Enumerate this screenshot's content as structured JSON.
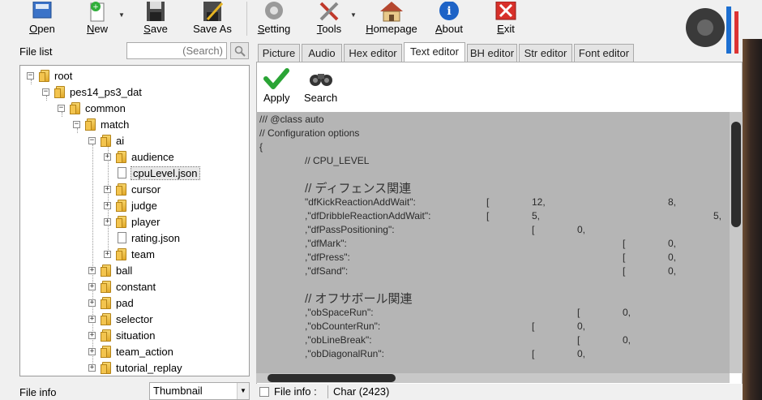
{
  "toolbar": {
    "open": "Open",
    "new": "New",
    "save": "Save",
    "save_as": "Save As",
    "setting": "Setting",
    "tools": "Tools",
    "homepage": "Homepage",
    "about": "About",
    "exit": "Exit"
  },
  "file_list": {
    "label": "File list",
    "search_placeholder": "(Search)"
  },
  "tree": {
    "root": "root",
    "pes": "pes14_ps3_dat",
    "common": "common",
    "match": "match",
    "ai": "ai",
    "audience": "audience",
    "cpulevel": "cpuLevel.json",
    "cursor": "cursor",
    "judge": "judge",
    "player": "player",
    "rating": "rating.json",
    "team": "team",
    "ball": "ball",
    "constant": "constant",
    "pad": "pad",
    "selector": "selector",
    "situation": "situation",
    "team_action": "team_action",
    "tutorial_replay": "tutorial_replay"
  },
  "file_info": {
    "label": "File info",
    "select_value": "Thumbnail"
  },
  "tabs": [
    "Picture",
    "Audio",
    "Hex editor",
    "Text editor",
    "BH editor",
    "Str editor",
    "Font editor"
  ],
  "editor": {
    "apply": "Apply",
    "search": "Search"
  },
  "code": {
    "l1": "/// @class auto",
    "l2": "// Configuration options",
    "l3": "{",
    "l4": "// CPU_LEVEL",
    "l5": "// ディフェンス関連",
    "l6a": "\"dfKickReactionAddWait\":",
    "l6b": "[",
    "l6c": "12,",
    "l6d": "8,",
    "l7a": ",\"dfDribbleReactionAddWait\":",
    "l7b": "[",
    "l7c": "5,",
    "l7d": "5,",
    "l8a": ",\"dfPassPositioning\":",
    "l8b": "[",
    "l8c": "0,",
    "l9a": ",\"dfMark\":",
    "l9b": "[",
    "l9c": "0,",
    "l10a": ",\"dfPress\":",
    "l10b": "[",
    "l10c": "0,",
    "l11a": ",\"dfSand\":",
    "l11b": "[",
    "l11c": "0,",
    "l12": "// オフサボール関連",
    "l13a": ",\"obSpaceRun\":",
    "l13b": "[",
    "l13c": "0,",
    "l14a": ",\"obCounterRun\":",
    "l14b": "[",
    "l14c": "0,",
    "l15a": ",\"obLineBreak\":",
    "l15b": "[",
    "l15c": "0,",
    "l16a": ",\"obDiagonalRun\":",
    "l16b": "[",
    "l16c": "0,"
  },
  "status": {
    "label": "File info :",
    "value": "Char (2423)"
  }
}
